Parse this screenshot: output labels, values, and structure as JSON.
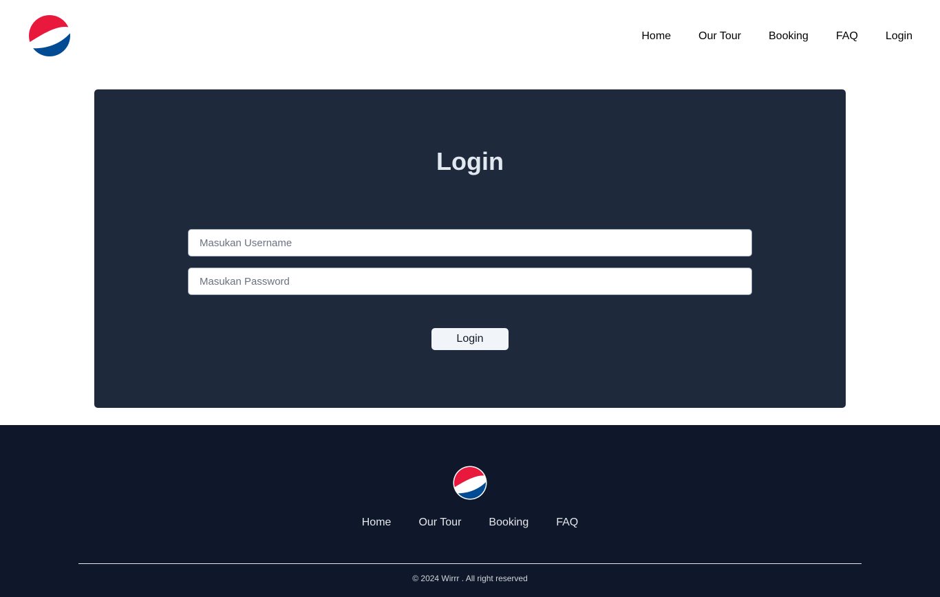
{
  "brand": {
    "logo_icon": "pepsi-globe-logo",
    "colors": {
      "red": "#e8193c",
      "blue": "#004b93",
      "white": "#ffffff"
    }
  },
  "nav": {
    "items": [
      {
        "label": "Home"
      },
      {
        "label": "Our Tour"
      },
      {
        "label": "Booking"
      },
      {
        "label": "FAQ"
      },
      {
        "label": "Login"
      }
    ]
  },
  "login": {
    "title": "Login",
    "username": {
      "placeholder": "Masukan Username",
      "value": ""
    },
    "password": {
      "placeholder": "Masukan Password",
      "value": ""
    },
    "button_label": "Login",
    "card_color": "#1e293b"
  },
  "footer": {
    "links": [
      {
        "label": "Home"
      },
      {
        "label": "Our Tour"
      },
      {
        "label": "Booking"
      },
      {
        "label": "FAQ"
      }
    ],
    "copyright": "© 2024 Wirrr . All right reserved",
    "background": "#0f172a"
  }
}
